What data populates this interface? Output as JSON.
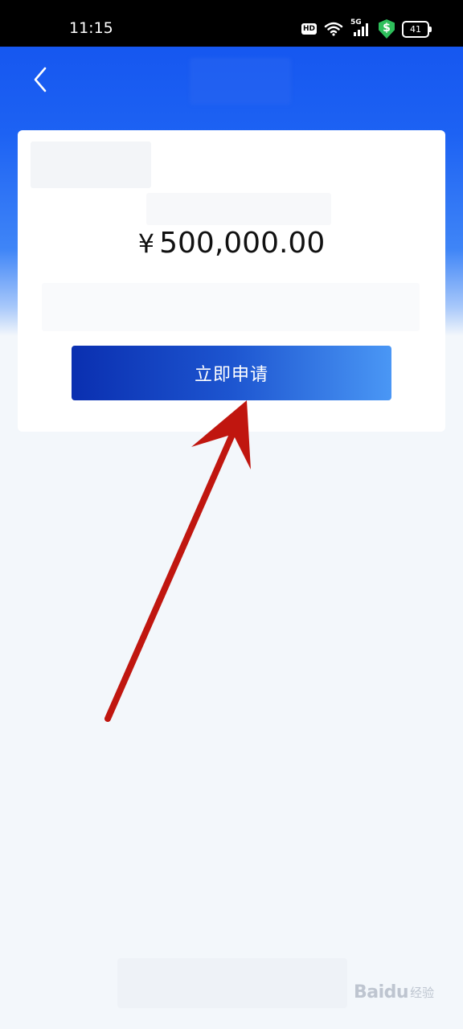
{
  "status_bar": {
    "time": "11:15",
    "hd_label": "HD",
    "network_label": "5G",
    "shield_label": "$",
    "battery_level": "41",
    "icons": [
      "hd-icon",
      "wifi-icon",
      "signal-5g-icon",
      "shield-icon",
      "battery-icon"
    ]
  },
  "header": {
    "back_icon": "chevron-left-icon",
    "background_color": "#1d62f3"
  },
  "card": {
    "amount": {
      "currency_sign": "¥",
      "value": "500,000.00"
    },
    "apply_button_label": "立即申请"
  },
  "annotation": {
    "arrow_color": "#c0160f"
  },
  "watermark": {
    "brand": "Baidu",
    "suffix": "经验"
  },
  "colors": {
    "accent": "#1657f0",
    "button_start": "#0a2fb0",
    "button_end": "#4a97f5",
    "page_background": "#f3f7fb"
  }
}
